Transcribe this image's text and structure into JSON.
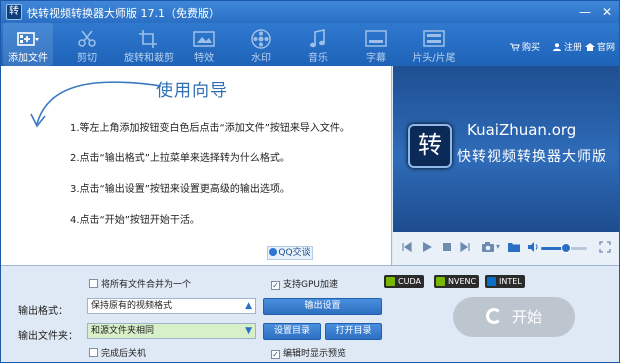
{
  "window": {
    "title": "快转视频转换器大师版 17.1（免费版）",
    "logo_char": "转",
    "minimize_glyph": "—",
    "close_glyph": "✕"
  },
  "toolbar": {
    "items": [
      {
        "label": "添加文件",
        "icon": "add-file-icon",
        "active": true
      },
      {
        "label": "剪切",
        "icon": "scissors-icon"
      },
      {
        "label": "旋转和裁剪",
        "icon": "rotate-crop-icon"
      },
      {
        "label": "特效",
        "icon": "effects-icon"
      },
      {
        "label": "水印",
        "icon": "watermark-icon"
      },
      {
        "label": "音乐",
        "icon": "music-icon"
      },
      {
        "label": "字幕",
        "icon": "subtitle-icon"
      },
      {
        "label": "片头/片尾",
        "icon": "intro-outro-icon"
      }
    ],
    "links": [
      {
        "label": "购买",
        "icon": "cart-icon"
      },
      {
        "label": "注册",
        "icon": "user-icon"
      },
      {
        "label": "官网",
        "icon": "home-icon"
      }
    ]
  },
  "guide": {
    "title": "使用向导",
    "steps": [
      "1.等左上角添加按钮变白色后点击“添加文件”按钮来导入文件。",
      "2.点击“输出格式”上拉菜单来选择转为什么格式。",
      "3.点击“输出设置”按钮来设置更高级的输出选项。",
      "4.点击“开始”按钮开始干活。"
    ],
    "qq_label": "QQ交谈"
  },
  "preview": {
    "logo_char": "转",
    "site": "KuaiZhuan.org",
    "name": "快转视频转换器大师版"
  },
  "player": {
    "volume": 0.55,
    "colors": {
      "accent": "#2a6fc4"
    }
  },
  "settings": {
    "merge_label": "将所有文件合并为一个",
    "merge_checked": false,
    "gpu_label": "支持GPU加速",
    "gpu_checked": true,
    "badges": [
      "CUDA",
      "NVENC",
      "INTEL"
    ],
    "format_label": "输出格式：",
    "format_value": "保持原有的视频格式",
    "folder_label": "输出文件夹：",
    "folder_value": "和源文件夹相同",
    "output_settings_label": "输出设置",
    "set_dir_label": "设置目录",
    "open_dir_label": "打开目录",
    "shutdown_label": "完成后关机",
    "shutdown_checked": false,
    "preview_label": "编辑时显示预览",
    "preview_checked": true,
    "start_label": "开始"
  }
}
